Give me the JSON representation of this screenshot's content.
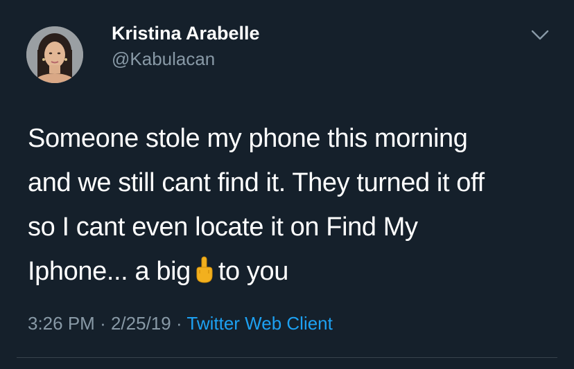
{
  "user": {
    "display_name": "Kristina Arabelle",
    "handle": "@Kabulacan"
  },
  "tweet": {
    "lines": [
      "Someone stole my phone this morning",
      "and we still cant find it. They turned it off",
      "so I cant even locate it on Find My"
    ],
    "last_line_before_emoji": "Iphone... a big",
    "emoji": "middle-finger-emoji",
    "last_line_after_emoji": "to you"
  },
  "meta": {
    "time": "3:26 PM",
    "separator": "·",
    "date": "2/25/19",
    "client": "Twitter Web Client"
  },
  "icons": {
    "options": "chevron-down-icon"
  },
  "colors": {
    "background": "#15202b",
    "text_primary": "#ffffff",
    "text_secondary": "#8899a6",
    "link": "#1da1f2",
    "divider": "#38444d"
  }
}
